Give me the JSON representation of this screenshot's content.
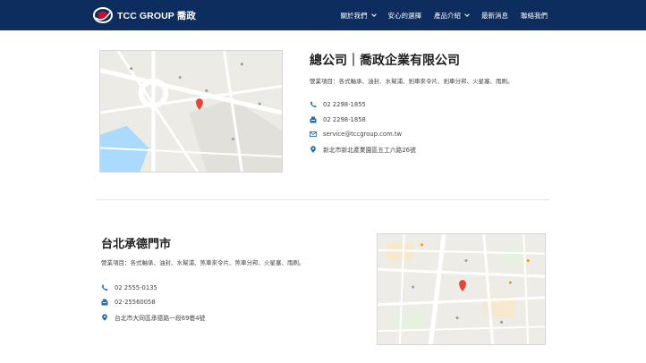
{
  "brand": {
    "name": "TCC GROUP 喬政",
    "accent": "#0c2d5e"
  },
  "nav": [
    {
      "label": "關於我們",
      "has_dropdown": true
    },
    {
      "label": "安心的選擇",
      "has_dropdown": false
    },
    {
      "label": "產品介紹",
      "has_dropdown": true
    },
    {
      "label": "最新消息",
      "has_dropdown": false
    },
    {
      "label": "聯絡我們",
      "has_dropdown": false
    }
  ],
  "branches": [
    {
      "title": "總公司｜喬政企業有限公司",
      "description": "營業項目：各式軸承、油封、水幫浦、剎車來令片、剎車分邦、火星塞、雨刷。",
      "phone": "02 2298-1855",
      "fax": "02 2298-1858",
      "email": "service@tccgroup.com.tw",
      "address": "新北市新北產業園區五工六路26號"
    },
    {
      "title": "台北承德門市",
      "description": "營業項目：各式軸承、油封、水幫浦、煞車來令片、煞車分邦、火星塞、雨刷。",
      "phone": "02 2555-0135",
      "fax": "02-25560058",
      "address": "台北市大同區承德路一段69巷4號"
    }
  ],
  "icons": {
    "phone": "phone-icon",
    "fax": "fax-icon",
    "email": "envelope-icon",
    "address": "map-pin-icon",
    "color": "#1f6fb5"
  }
}
